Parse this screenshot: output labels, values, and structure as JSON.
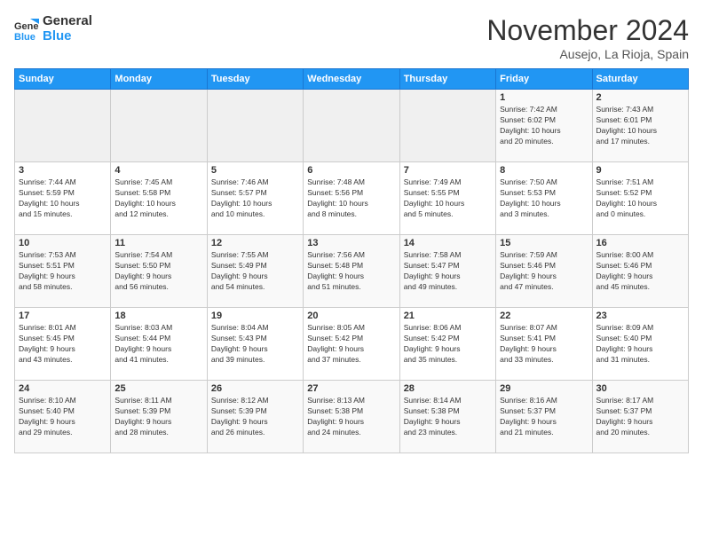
{
  "logo": {
    "line1": "General",
    "line2": "Blue"
  },
  "title": "November 2024",
  "subtitle": "Ausejo, La Rioja, Spain",
  "weekdays": [
    "Sunday",
    "Monday",
    "Tuesday",
    "Wednesday",
    "Thursday",
    "Friday",
    "Saturday"
  ],
  "weeks": [
    [
      {
        "day": "",
        "info": ""
      },
      {
        "day": "",
        "info": ""
      },
      {
        "day": "",
        "info": ""
      },
      {
        "day": "",
        "info": ""
      },
      {
        "day": "",
        "info": ""
      },
      {
        "day": "1",
        "info": "Sunrise: 7:42 AM\nSunset: 6:02 PM\nDaylight: 10 hours\nand 20 minutes."
      },
      {
        "day": "2",
        "info": "Sunrise: 7:43 AM\nSunset: 6:01 PM\nDaylight: 10 hours\nand 17 minutes."
      }
    ],
    [
      {
        "day": "3",
        "info": "Sunrise: 7:44 AM\nSunset: 5:59 PM\nDaylight: 10 hours\nand 15 minutes."
      },
      {
        "day": "4",
        "info": "Sunrise: 7:45 AM\nSunset: 5:58 PM\nDaylight: 10 hours\nand 12 minutes."
      },
      {
        "day": "5",
        "info": "Sunrise: 7:46 AM\nSunset: 5:57 PM\nDaylight: 10 hours\nand 10 minutes."
      },
      {
        "day": "6",
        "info": "Sunrise: 7:48 AM\nSunset: 5:56 PM\nDaylight: 10 hours\nand 8 minutes."
      },
      {
        "day": "7",
        "info": "Sunrise: 7:49 AM\nSunset: 5:55 PM\nDaylight: 10 hours\nand 5 minutes."
      },
      {
        "day": "8",
        "info": "Sunrise: 7:50 AM\nSunset: 5:53 PM\nDaylight: 10 hours\nand 3 minutes."
      },
      {
        "day": "9",
        "info": "Sunrise: 7:51 AM\nSunset: 5:52 PM\nDaylight: 10 hours\nand 0 minutes."
      }
    ],
    [
      {
        "day": "10",
        "info": "Sunrise: 7:53 AM\nSunset: 5:51 PM\nDaylight: 9 hours\nand 58 minutes."
      },
      {
        "day": "11",
        "info": "Sunrise: 7:54 AM\nSunset: 5:50 PM\nDaylight: 9 hours\nand 56 minutes."
      },
      {
        "day": "12",
        "info": "Sunrise: 7:55 AM\nSunset: 5:49 PM\nDaylight: 9 hours\nand 54 minutes."
      },
      {
        "day": "13",
        "info": "Sunrise: 7:56 AM\nSunset: 5:48 PM\nDaylight: 9 hours\nand 51 minutes."
      },
      {
        "day": "14",
        "info": "Sunrise: 7:58 AM\nSunset: 5:47 PM\nDaylight: 9 hours\nand 49 minutes."
      },
      {
        "day": "15",
        "info": "Sunrise: 7:59 AM\nSunset: 5:46 PM\nDaylight: 9 hours\nand 47 minutes."
      },
      {
        "day": "16",
        "info": "Sunrise: 8:00 AM\nSunset: 5:46 PM\nDaylight: 9 hours\nand 45 minutes."
      }
    ],
    [
      {
        "day": "17",
        "info": "Sunrise: 8:01 AM\nSunset: 5:45 PM\nDaylight: 9 hours\nand 43 minutes."
      },
      {
        "day": "18",
        "info": "Sunrise: 8:03 AM\nSunset: 5:44 PM\nDaylight: 9 hours\nand 41 minutes."
      },
      {
        "day": "19",
        "info": "Sunrise: 8:04 AM\nSunset: 5:43 PM\nDaylight: 9 hours\nand 39 minutes."
      },
      {
        "day": "20",
        "info": "Sunrise: 8:05 AM\nSunset: 5:42 PM\nDaylight: 9 hours\nand 37 minutes."
      },
      {
        "day": "21",
        "info": "Sunrise: 8:06 AM\nSunset: 5:42 PM\nDaylight: 9 hours\nand 35 minutes."
      },
      {
        "day": "22",
        "info": "Sunrise: 8:07 AM\nSunset: 5:41 PM\nDaylight: 9 hours\nand 33 minutes."
      },
      {
        "day": "23",
        "info": "Sunrise: 8:09 AM\nSunset: 5:40 PM\nDaylight: 9 hours\nand 31 minutes."
      }
    ],
    [
      {
        "day": "24",
        "info": "Sunrise: 8:10 AM\nSunset: 5:40 PM\nDaylight: 9 hours\nand 29 minutes."
      },
      {
        "day": "25",
        "info": "Sunrise: 8:11 AM\nSunset: 5:39 PM\nDaylight: 9 hours\nand 28 minutes."
      },
      {
        "day": "26",
        "info": "Sunrise: 8:12 AM\nSunset: 5:39 PM\nDaylight: 9 hours\nand 26 minutes."
      },
      {
        "day": "27",
        "info": "Sunrise: 8:13 AM\nSunset: 5:38 PM\nDaylight: 9 hours\nand 24 minutes."
      },
      {
        "day": "28",
        "info": "Sunrise: 8:14 AM\nSunset: 5:38 PM\nDaylight: 9 hours\nand 23 minutes."
      },
      {
        "day": "29",
        "info": "Sunrise: 8:16 AM\nSunset: 5:37 PM\nDaylight: 9 hours\nand 21 minutes."
      },
      {
        "day": "30",
        "info": "Sunrise: 8:17 AM\nSunset: 5:37 PM\nDaylight: 9 hours\nand 20 minutes."
      }
    ]
  ]
}
